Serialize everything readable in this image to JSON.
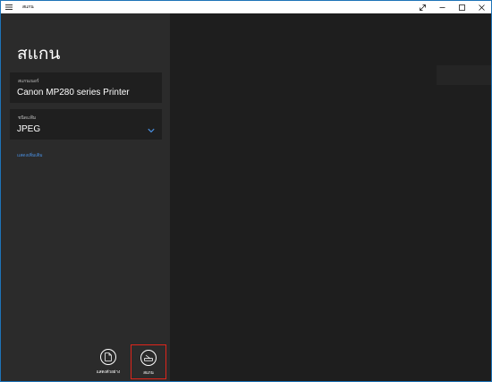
{
  "window": {
    "title": "สแกน",
    "accent": "#1e74b8",
    "highlight": "#e0251b"
  },
  "page": {
    "heading": "สแกน"
  },
  "scanner": {
    "caption": "สแกนเนอร์",
    "value": "Canon MP280 series Printer"
  },
  "file_type": {
    "caption": "ชนิดแฟ้ม",
    "value": "JPEG",
    "icon": "chevron-down-icon"
  },
  "more_link": "แสดงเพิ่มเติม",
  "commands": {
    "preview_label": "แสดงตัวอย่าง",
    "scan_label": "สแกน"
  }
}
